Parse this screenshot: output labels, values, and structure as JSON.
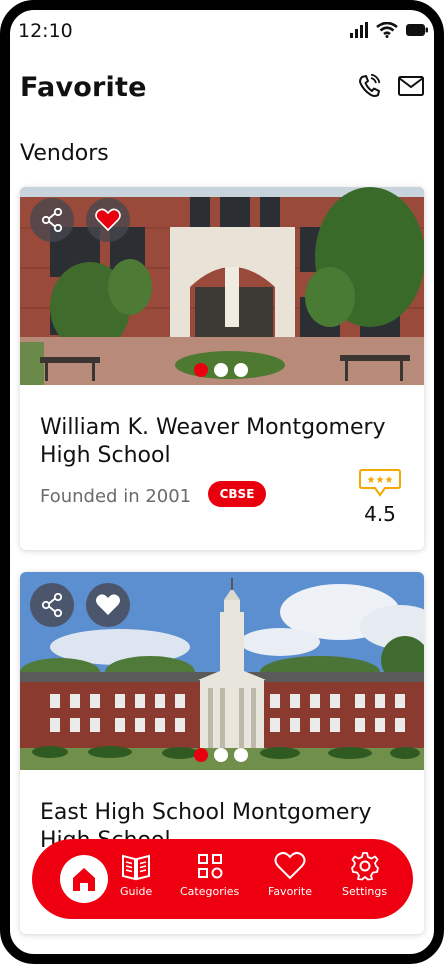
{
  "status_bar": {
    "time": "12:10"
  },
  "header": {
    "title": "Favorite",
    "phone_icon": "phone-icon",
    "mail_icon": "mail-icon"
  },
  "section": {
    "title": "Vendors"
  },
  "vendors": [
    {
      "name": "William K. Weaver Montgomery High School",
      "founded": "Founded in 2001",
      "board": "CBSE",
      "rating": "4.5",
      "favorited": true
    },
    {
      "name": "East High School Montgomery High School",
      "favorited": false
    }
  ],
  "nav": {
    "items": [
      {
        "label": "Guide",
        "icon": "book-icon"
      },
      {
        "label": "Categories",
        "icon": "grid-icon"
      },
      {
        "label": "Favorite",
        "icon": "heart-icon"
      },
      {
        "label": "Settings",
        "icon": "gear-icon"
      }
    ],
    "home_icon": "home-icon"
  },
  "colors": {
    "accent": "#e8000e",
    "rating": "#f2a900"
  }
}
